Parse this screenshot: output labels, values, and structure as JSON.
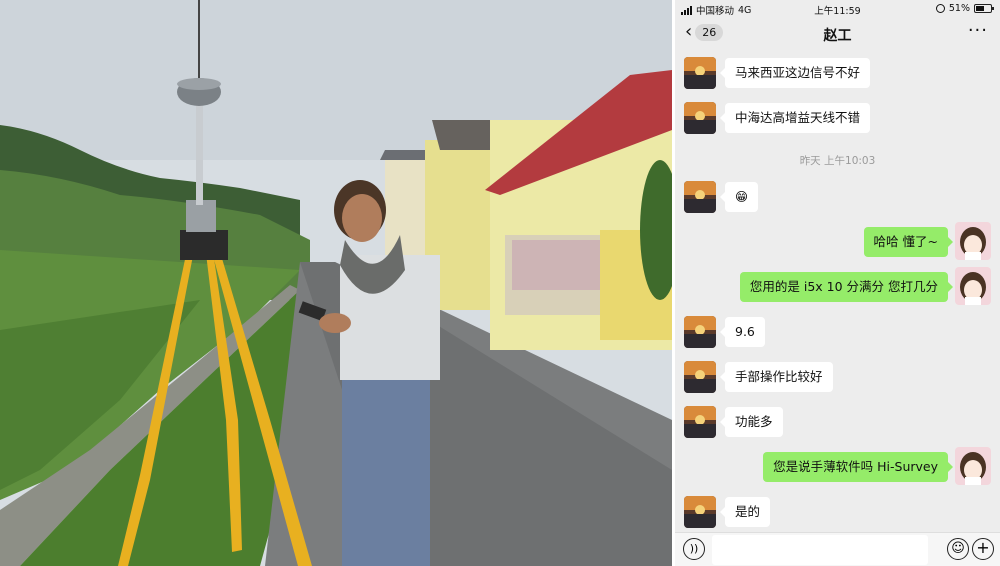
{
  "status_bar": {
    "carrier": "中国移动",
    "network": "4G",
    "time": "上午11:59",
    "battery": "51%"
  },
  "chat": {
    "back_count": "26",
    "title": "赵工",
    "more_icon": "ellipsis-icon",
    "timestamp": "昨天 上午10:03",
    "messages": [
      {
        "side": "in",
        "text": "马来西亚这边信号不好"
      },
      {
        "side": "in",
        "text": "中海达高增益天线不错"
      },
      {
        "side": "in",
        "text": "😁"
      },
      {
        "side": "out",
        "text": "哈哈 懂了~"
      },
      {
        "side": "out",
        "text": "您用的是 i5x  10 分满分  您打几分"
      },
      {
        "side": "in",
        "text": "9.6"
      },
      {
        "side": "in",
        "text": "手部操作比较好"
      },
      {
        "side": "in",
        "text": "功能多"
      },
      {
        "side": "out",
        "text": "您是说手薄软件吗  Hi-Survey"
      },
      {
        "side": "in",
        "text": "是的"
      }
    ]
  },
  "input_bar": {
    "voice_icon": "voice-icon",
    "emoji_icon": "emoji-icon",
    "plus_icon": "plus-icon",
    "value": ""
  },
  "colors": {
    "chat_bg": "#ededed",
    "out_bubble": "#95ec69",
    "in_bubble": "#ffffff"
  }
}
